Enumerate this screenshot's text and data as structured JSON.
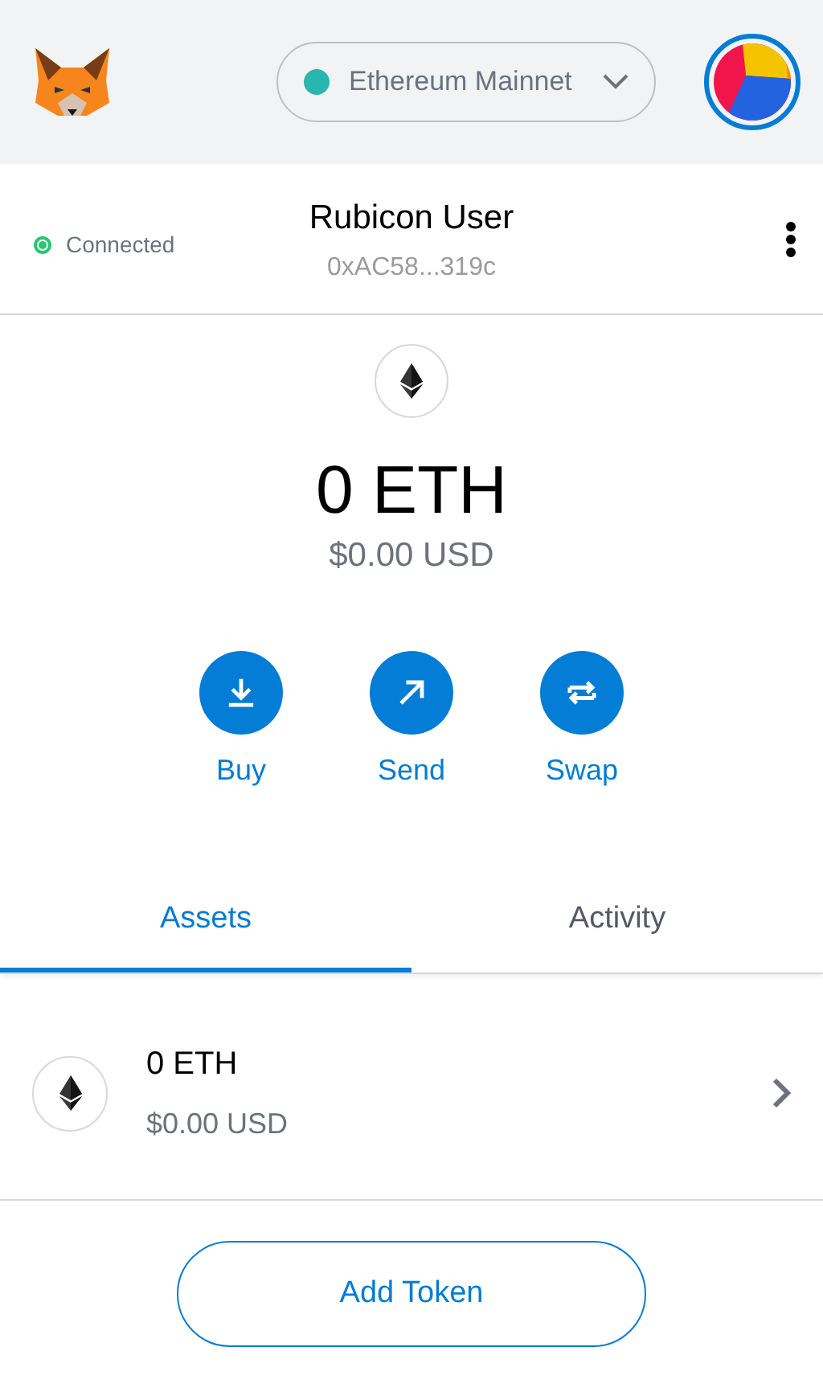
{
  "header": {
    "network": {
      "label": "Ethereum Mainnet",
      "color": "#29b6af"
    }
  },
  "account": {
    "status": {
      "label": "Connected",
      "connected": true
    },
    "name": "Rubicon User",
    "address": "0xAC58...319c"
  },
  "balance": {
    "amount": "0 ETH",
    "fiat": "$0.00 USD"
  },
  "actions": [
    {
      "kind": "buy",
      "label": "Buy"
    },
    {
      "kind": "send",
      "label": "Send"
    },
    {
      "kind": "swap",
      "label": "Swap"
    }
  ],
  "tabs": [
    {
      "label": "Assets",
      "selected": true
    },
    {
      "label": "Activity",
      "selected": false
    }
  ],
  "assets": [
    {
      "amount": "0 ETH",
      "fiat": "$0.00 USD"
    }
  ],
  "add_token_button": "Add Token"
}
